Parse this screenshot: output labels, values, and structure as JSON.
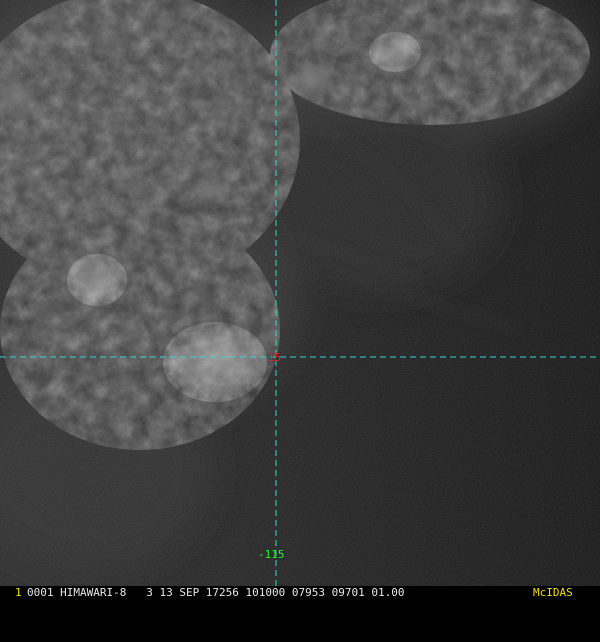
{
  "overlay": {
    "latitude_label": "15",
    "longitude_label": "-115",
    "grid_color": "#33d6d6",
    "latitude_label_color": "#ff2b2b",
    "longitude_label_color": "#33ff33"
  },
  "status_bar": {
    "frame_number": "1",
    "text": "0001 HIMAWARI-8   3 13 SEP 17256 101000 07953 09701 01.00",
    "brand": "McIDAS",
    "frame_number_color": "#f0e000",
    "brand_color": "#f0e000",
    "text_color": "#e8e8e8"
  },
  "icons": {
    "satellite_image": "satellite-image"
  }
}
